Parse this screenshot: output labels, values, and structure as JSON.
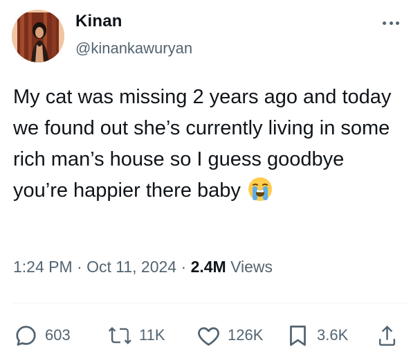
{
  "author": {
    "name": "Kinan",
    "handle": "@kinankawuryan"
  },
  "tweet": {
    "text": "My cat was missing 2 years ago and today we found out she’s currently living in some rich man’s house so I guess goodbye you’re happier there baby",
    "emoji": "loudly-crying-face-icon"
  },
  "meta": {
    "time": "1:24 PM",
    "separator1": "·",
    "date": "Oct 11, 2024",
    "separator2": "·",
    "views_count": "2.4M",
    "views_label": "Views"
  },
  "actions": {
    "replies": "603",
    "reposts": "11K",
    "likes": "126K",
    "bookmarks": "3.6K"
  },
  "colors": {
    "text": "#0f1419",
    "secondary": "#536471",
    "divider": "#eff3f4"
  }
}
